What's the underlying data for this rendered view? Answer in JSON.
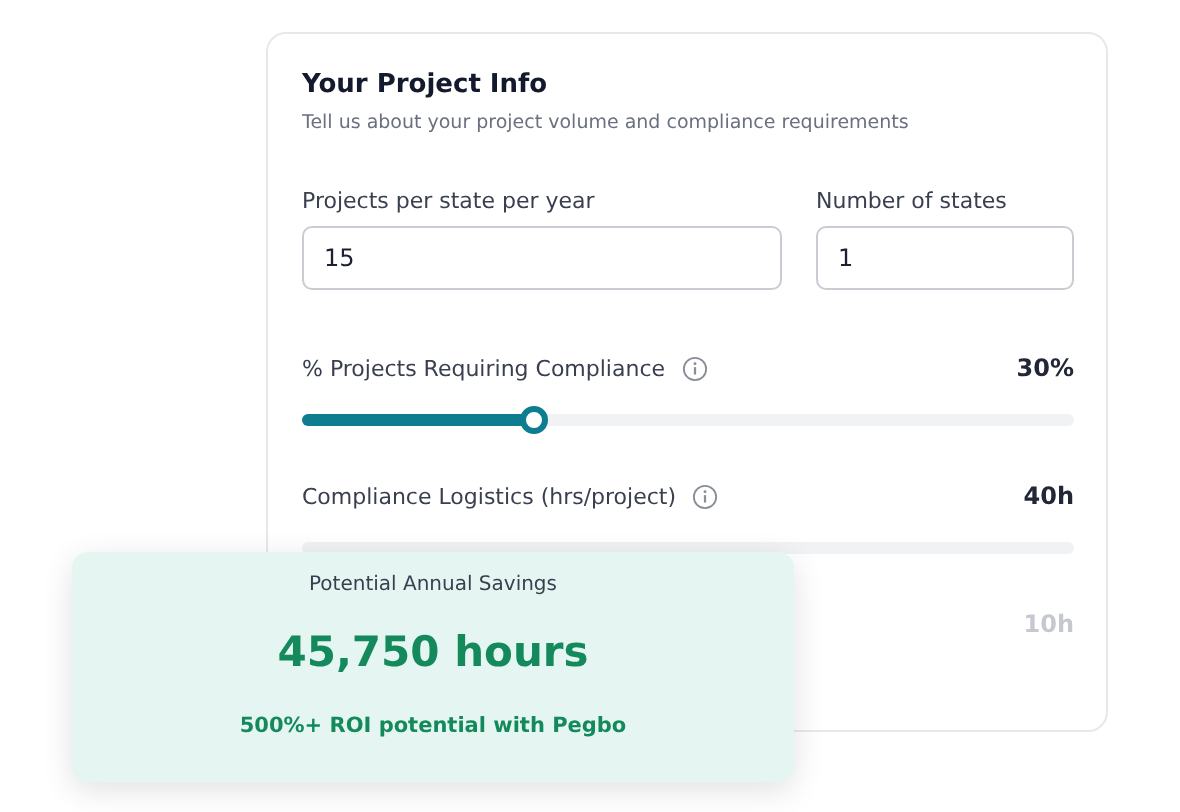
{
  "card": {
    "title": "Your Project Info",
    "subtitle": "Tell us about your project volume and compliance requirements"
  },
  "fields": [
    {
      "label": "Projects per state per year",
      "value": "15"
    },
    {
      "label": "Number of states",
      "value": "1"
    }
  ],
  "sliders": [
    {
      "label": "% Projects Requiring Compliance",
      "reading": "30%",
      "level": 0.3,
      "faded": false
    },
    {
      "label": "Compliance Logistics (hrs/project)",
      "reading": "40h",
      "faded": false
    },
    {
      "reading": "10h",
      "faded": true
    }
  ],
  "savings": {
    "caption": "Potential Annual Savings",
    "amount": "45,750 hours",
    "note": "500%+ ROI potential with Pegbo"
  }
}
